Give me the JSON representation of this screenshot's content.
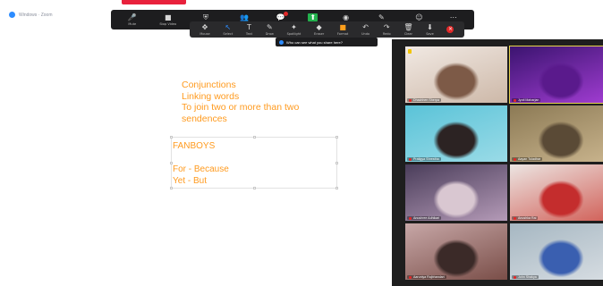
{
  "window": {
    "title": "Windows · Zoom"
  },
  "toolbar": {
    "items": [
      {
        "icon": "microphone-icon",
        "glyph": "🎤",
        "label": "Mute"
      },
      {
        "icon": "camera-icon",
        "glyph": "■",
        "label": "Stop Video"
      },
      {
        "icon": "security-icon",
        "glyph": "⛨",
        "label": "Security"
      },
      {
        "icon": "participants-icon",
        "glyph": "👥",
        "label": "Participants"
      },
      {
        "icon": "chat-icon",
        "glyph": "💬",
        "label": "Chat"
      },
      {
        "icon": "share-screen-icon",
        "glyph": "⬆",
        "label": "Share"
      },
      {
        "icon": "record-icon",
        "glyph": "◉",
        "label": "Record"
      },
      {
        "icon": "annotate-icon",
        "glyph": "✎",
        "label": "Annotate"
      },
      {
        "icon": "reactions-icon",
        "glyph": "☺",
        "label": "Reactions"
      },
      {
        "icon": "more-icon",
        "glyph": "⋯",
        "label": "More"
      }
    ]
  },
  "annotation_toolbar": {
    "items": [
      {
        "icon": "mouse-icon",
        "glyph": "✥",
        "label": "Mouse"
      },
      {
        "icon": "select-icon",
        "glyph": "↖",
        "label": "Select"
      },
      {
        "icon": "text-icon",
        "glyph": "T",
        "label": "Text"
      },
      {
        "icon": "draw-icon",
        "glyph": "✎",
        "label": "Draw"
      },
      {
        "icon": "spotlight-icon",
        "glyph": "✦",
        "label": "Spotlight"
      },
      {
        "icon": "eraser-icon",
        "glyph": "◆",
        "label": "Eraser"
      },
      {
        "icon": "format-icon",
        "glyph": "■",
        "label": "Format"
      },
      {
        "icon": "undo-icon",
        "glyph": "↶",
        "label": "Undo"
      },
      {
        "icon": "redo-icon",
        "glyph": "↷",
        "label": "Redo"
      },
      {
        "icon": "clear-icon",
        "glyph": "🗑",
        "label": "Clear"
      },
      {
        "icon": "save-icon",
        "glyph": "⬇",
        "label": "Save"
      },
      {
        "icon": "close-icon",
        "glyph": "×",
        "label": ""
      }
    ]
  },
  "hint": {
    "text": "Who can see what you share here?"
  },
  "annotations": {
    "top_lines": [
      "Conjunctions",
      "Linking words",
      "To join two or more than two",
      "sendences"
    ],
    "box_lines": [
      "FANBOYS",
      "",
      "For - Because",
      "Yet - But"
    ]
  },
  "gallery": {
    "tiles": [
      {
        "name": "Dhachhen Sherpa",
        "colors": [
          "#f1e9e3",
          "#cdb8a8",
          "#7d5a47"
        ]
      },
      {
        "name": "Jyoti Maharjan",
        "colors": [
          "#3b1470",
          "#a23dd3",
          "#5a1a8c"
        ]
      },
      {
        "name": "Pratigya Shrestha",
        "colors": [
          "#5ac3d8",
          "#9adbe7",
          "#2c2323"
        ]
      },
      {
        "name": "Aayan Tuladhar",
        "colors": [
          "#8c7a55",
          "#c9b48d",
          "#5a4a36"
        ]
      },
      {
        "name": "Anushree Adhikari",
        "colors": [
          "#4a3d5a",
          "#b49ab7",
          "#d9c7d1"
        ]
      },
      {
        "name": "Anushka Rai",
        "colors": [
          "#ece5e2",
          "#d15f57",
          "#c42d2d"
        ]
      },
      {
        "name": "Aaruniya Rajbhandari",
        "colors": [
          "#c7a7a7",
          "#7a4e48",
          "#3b2a28"
        ]
      },
      {
        "name": "John Shakya",
        "colors": [
          "#a6b7c2",
          "#d7dde2",
          "#3a5fb0"
        ]
      }
    ]
  }
}
